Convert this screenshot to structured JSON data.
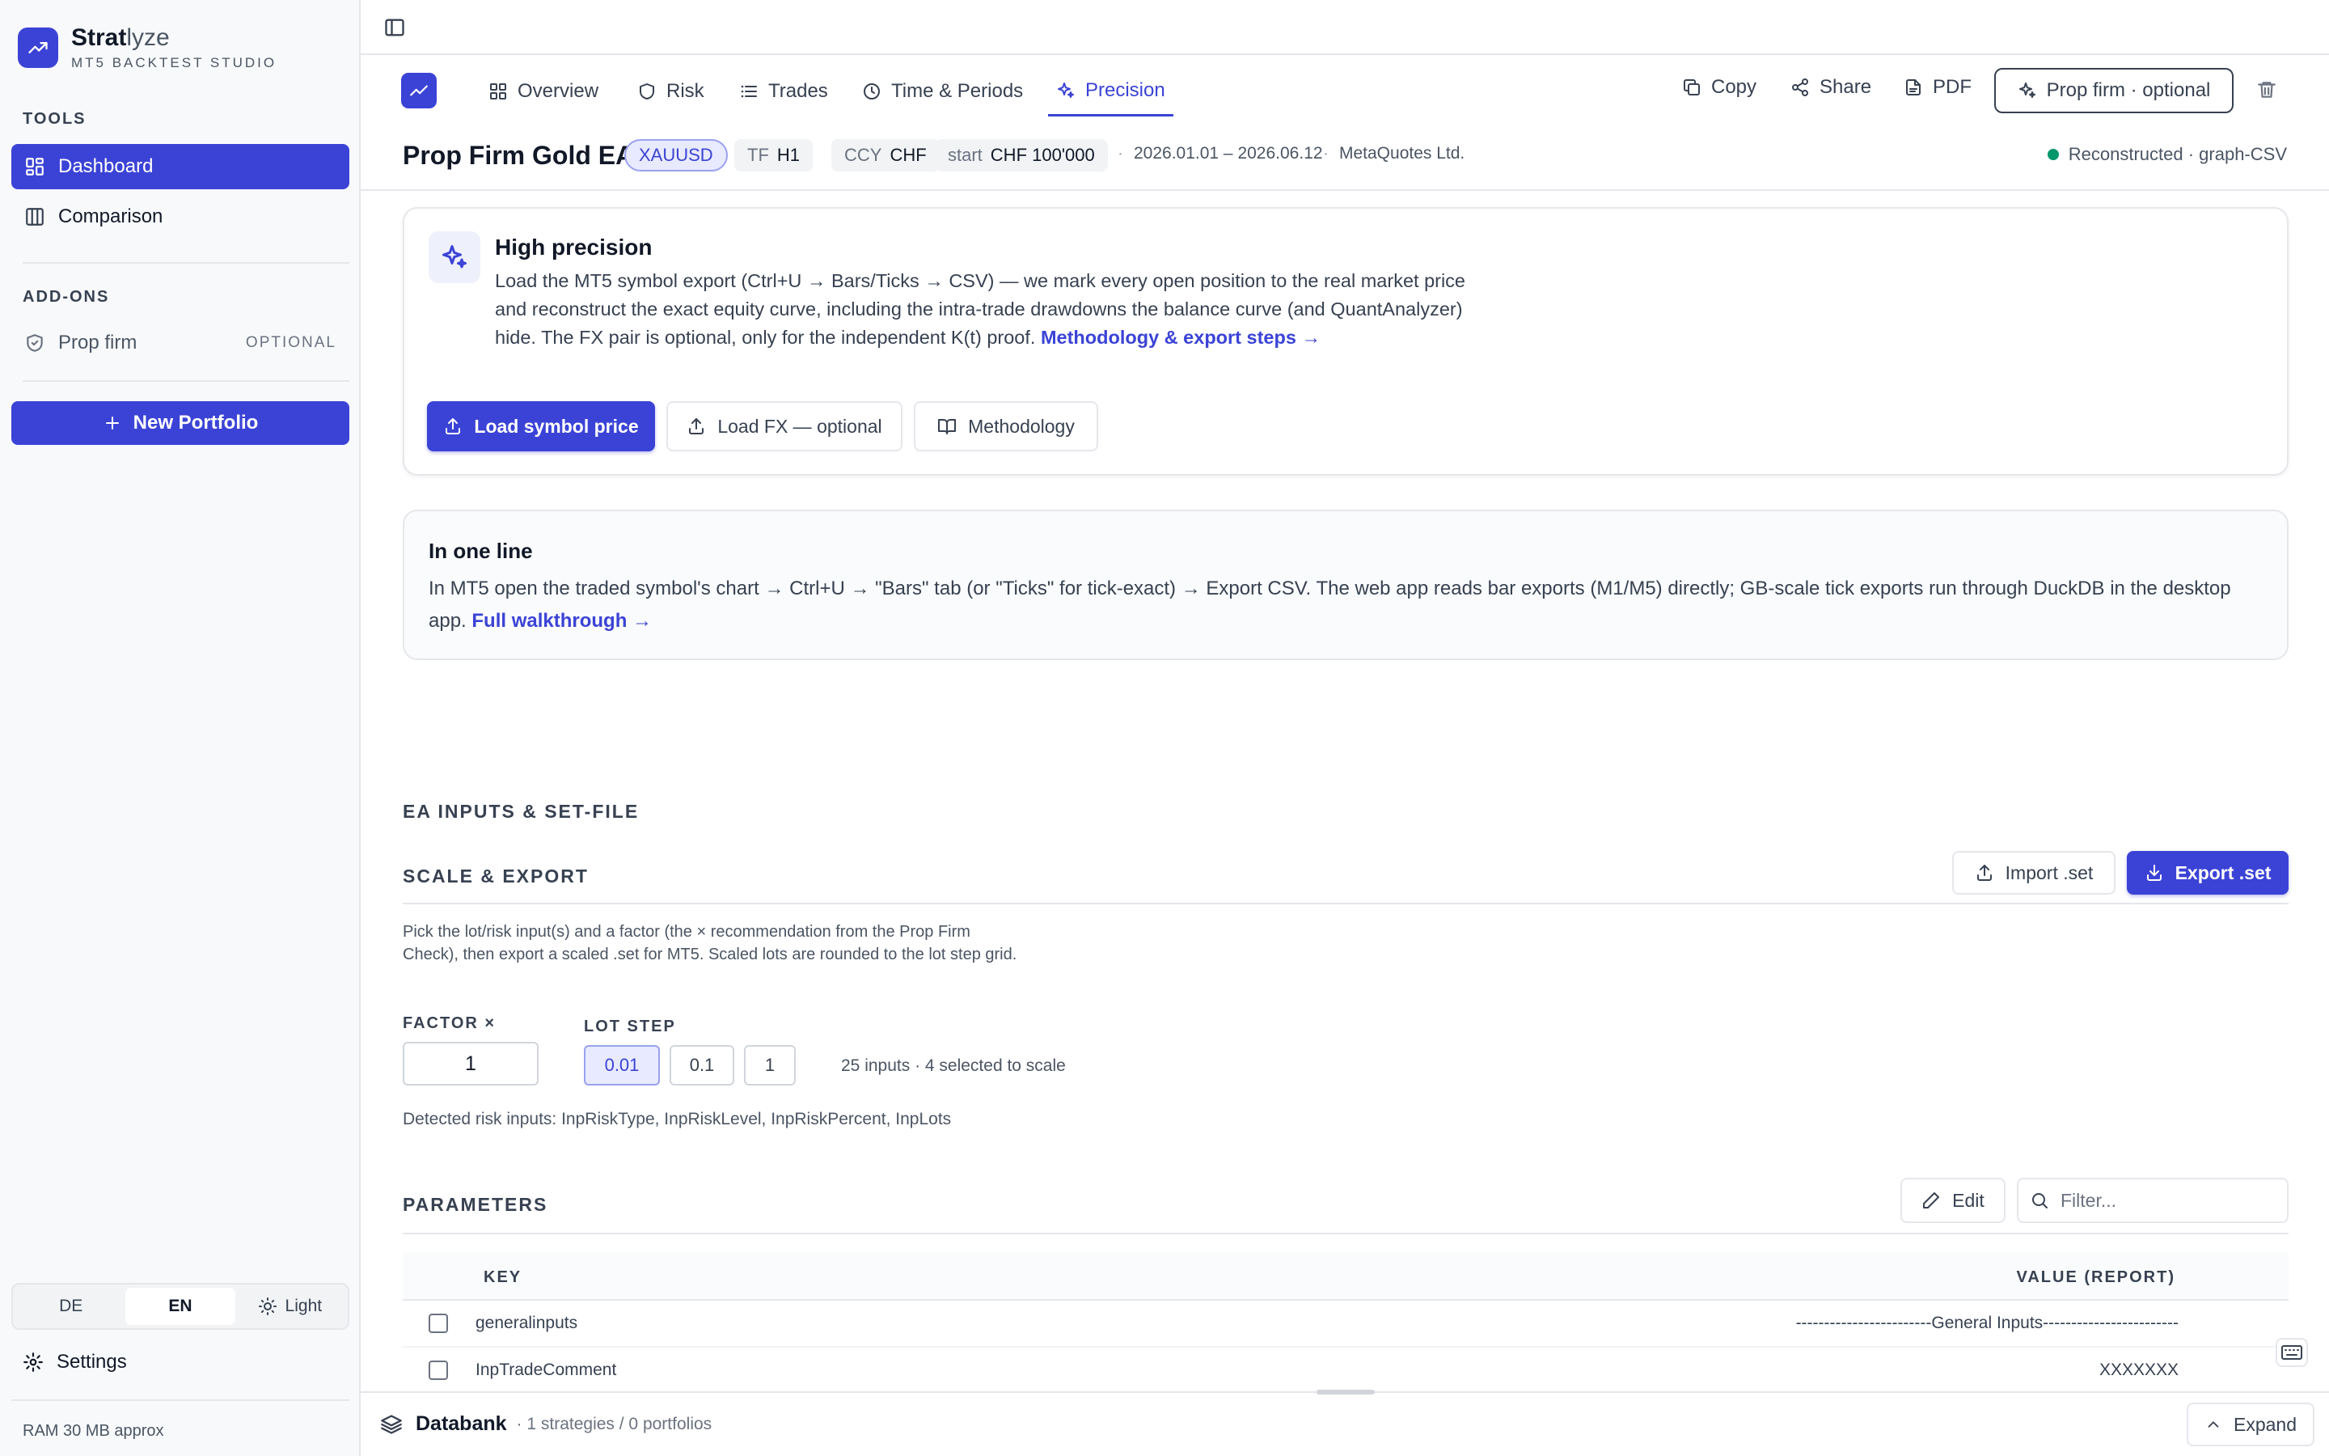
{
  "brand": {
    "name_main": "Strat",
    "name_rest": "lyze",
    "subtitle": "MT5 BACKTEST STUDIO"
  },
  "sidebar": {
    "tools_title": "TOOLS",
    "items": [
      {
        "label": "Dashboard"
      },
      {
        "label": "Comparison"
      }
    ],
    "addons_title": "ADD-ONS",
    "addon": {
      "label": "Prop firm",
      "badge": "OPTIONAL"
    },
    "new_portfolio": "New Portfolio",
    "lang": {
      "de": "DE",
      "en": "EN",
      "theme": "Light"
    },
    "settings": "Settings",
    "ram": "RAM 30 MB approx"
  },
  "tabs": [
    {
      "label": "Overview"
    },
    {
      "label": "Risk"
    },
    {
      "label": "Trades"
    },
    {
      "label": "Time & Periods"
    },
    {
      "label": "Precision"
    }
  ],
  "actions": {
    "copy": "Copy",
    "share": "Share",
    "pdf": "PDF",
    "prop_firm": "Prop firm · optional"
  },
  "strategy": {
    "title": "Prop Firm Gold EA",
    "symbol": "XAUUSD",
    "tf_key": "TF",
    "tf": "H1",
    "ccy_key": "CCY",
    "ccy": "CHF",
    "start_key": "start",
    "start": "CHF 100'000",
    "period": "2026.01.01 – 2026.06.12",
    "broker": "MetaQuotes Ltd.",
    "status": "Reconstructed · graph-CSV"
  },
  "precision": {
    "title": "High precision",
    "text": "Load the MT5 symbol export (Ctrl+U → Bars/Ticks → CSV) — we mark every open position to the real market price and reconstruct the exact equity curve, including the intra-trade drawdowns the balance curve (and QuantAnalyzer) hide. The FX pair is optional, only for the independent K(t) proof.",
    "link": "Methodology & export steps →",
    "btn_load_symbol": "Load symbol price",
    "btn_load_fx": "Load FX — optional",
    "btn_methodology": "Methodology"
  },
  "one_line": {
    "title": "In one line",
    "text": "In MT5 open the traded symbol's chart → Ctrl+U → \"Bars\" tab (or \"Ticks\" for tick-exact) → Export CSV. The web app reads bar exports (M1/M5) directly; GB-scale tick exports run through DuckDB in the desktop app.",
    "link": "Full walkthrough →"
  },
  "ea": {
    "section": "EA INPUTS & SET-FILE",
    "scale_title": "SCALE & EXPORT",
    "import": "Import .set",
    "export": "Export .set",
    "description": "Pick the lot/risk input(s) and a factor (the × recommendation from the Prop Firm Check), then export a scaled .set for MT5. Scaled lots are rounded to the lot step grid.",
    "factor_label": "FACTOR ×",
    "factor_value": "1",
    "lot_step_label": "LOT STEP",
    "lot_steps": [
      "0.01",
      "0.1",
      "1"
    ],
    "inputs_info": "25 inputs · 4 selected to scale",
    "detected": "Detected risk inputs: InpRiskType, InpRiskLevel, InpRiskPercent, InpLots"
  },
  "params": {
    "title": "PARAMETERS",
    "edit": "Edit",
    "filter_placeholder": "Filter...",
    "col_key": "KEY",
    "col_value": "VALUE (REPORT)",
    "rows": [
      {
        "key": "generalinputs",
        "value": "------------------------General Inputs------------------------"
      },
      {
        "key": "InpTradeComment",
        "value": "XXXXXXX"
      }
    ]
  },
  "databank": {
    "title": "Databank",
    "sub": "· 1 strategies / 0 portfolios",
    "expand": "Expand"
  },
  "colors": {
    "accent": "#3b43d6",
    "status_ok": "#059669"
  }
}
